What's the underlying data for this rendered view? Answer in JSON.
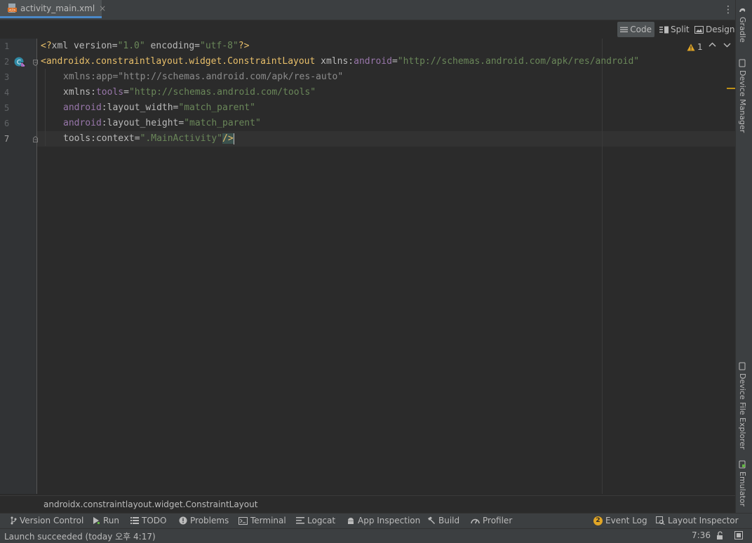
{
  "tab": {
    "filename": "activity_main.xml",
    "close": "×"
  },
  "menu": {
    "kebab": "⋮"
  },
  "view_modes": {
    "code": "Code",
    "split": "Split",
    "design": "Design"
  },
  "inspections": {
    "warning_count": "1",
    "up": "⌃",
    "down": "⌄"
  },
  "line_numbers": [
    "1",
    "2",
    "3",
    "4",
    "5",
    "6",
    "7"
  ],
  "code": {
    "l1": {
      "pi_open": "<?",
      "decl": "xml version=",
      "v1": "\"1.0\"",
      "enc": " encoding=",
      "v2": "\"utf-8\"",
      "pi_close": "?>"
    },
    "l2": {
      "tag": "<androidx.constraintlayout.widget.ConstraintLayout",
      "attr": " xmlns:",
      "ns": "android",
      "eq": "=",
      "val": "\"http://schemas.android.com/apk/res/android\""
    },
    "l3": {
      "attr": "xmlns:app=",
      "val": "\"http://schemas.android.com/apk/res-auto\""
    },
    "l4": {
      "attr": "xmlns:",
      "ns": "tools",
      "eq": "=",
      "val": "\"http://schemas.android.com/tools\""
    },
    "l5": {
      "ns": "android",
      "attr": ":layout_width",
      "eq": "=",
      "val": "\"match_parent\""
    },
    "l6": {
      "ns": "android",
      "attr": ":layout_height",
      "eq": "=",
      "val": "\"match_parent\""
    },
    "l7": {
      "ns": "tools",
      "attr": ":context",
      "eq": "=",
      "val": "\".MainActivity\"",
      "close": "/>"
    }
  },
  "breadcrumb": "androidx.constraintlayout.widget.ConstraintLayout",
  "right_tools": {
    "gradle": "Gradle",
    "device_manager": "Device Manager",
    "device_file_explorer": "Device File Explorer",
    "emulator": "Emulator"
  },
  "bottom_tools": {
    "version_control": "Version Control",
    "run": "Run",
    "todo": "TODO",
    "problems": "Problems",
    "terminal": "Terminal",
    "logcat": "Logcat",
    "app_inspection": "App Inspection",
    "build": "Build",
    "profiler": "Profiler",
    "event_log": "Event Log",
    "event_log_count": "2",
    "layout_inspector": "Layout Inspector"
  },
  "status": {
    "message": "Launch succeeded (today 오후 4:17)",
    "position": "7:36"
  },
  "colors": {
    "accent": "#4a88c7",
    "tag": "#e8bf6a",
    "value": "#6a8759",
    "namespace": "#9876aa",
    "warning": "#be9117"
  }
}
